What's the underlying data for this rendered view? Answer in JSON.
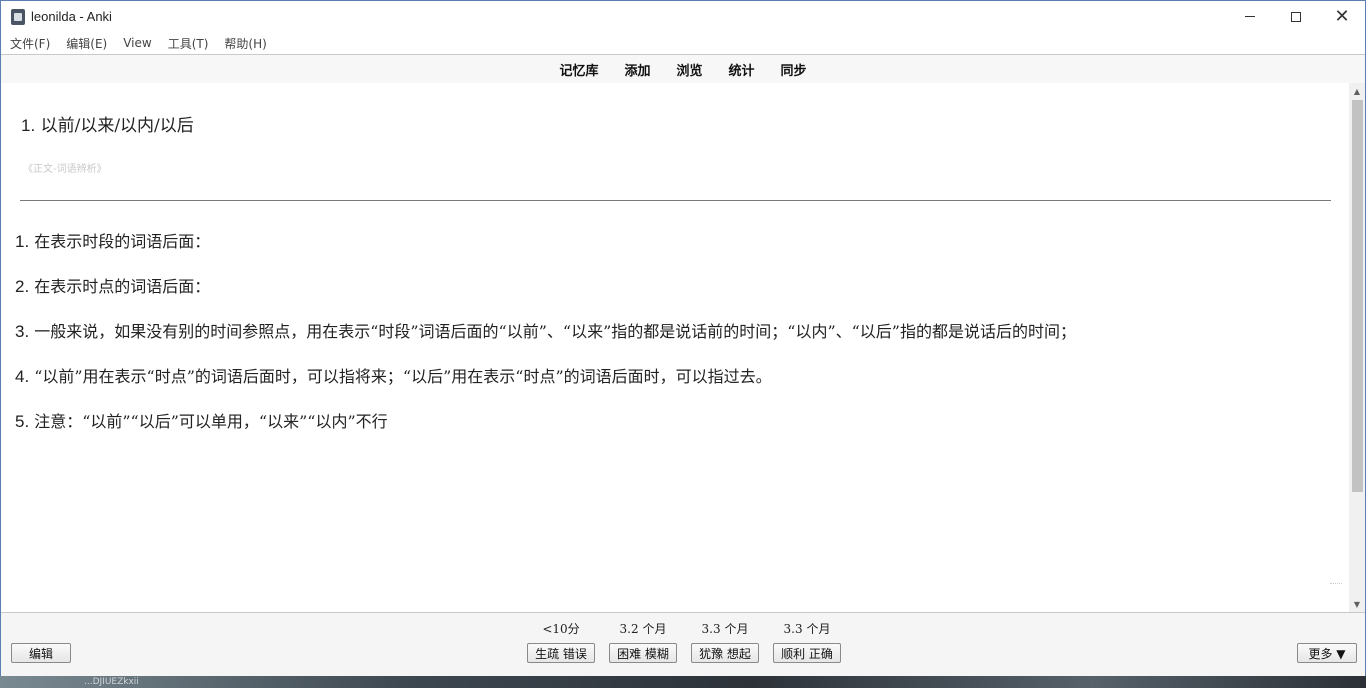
{
  "window": {
    "title": "leonilda - Anki"
  },
  "menubar": {
    "items": [
      "文件(F)",
      "编辑(E)",
      "View",
      "工具(T)",
      "帮助(H)"
    ]
  },
  "toolbar": {
    "items": [
      "记忆库",
      "添加",
      "浏览",
      "统计",
      "同步"
    ]
  },
  "card": {
    "question_num": "1.",
    "question_text": "以前/以来/以内/以后",
    "source": "《正文-词语辨析》",
    "answers": [
      {
        "num": "1.",
        "text": "在表示时段的词语后面："
      },
      {
        "num": "2.",
        "text": "在表示时点的词语后面："
      },
      {
        "num": "3.",
        "text": "一般来说，如果没有别的时间参照点，用在表示“时段”词语后面的“以前”、“以来”指的都是说话前的时间；“以内”、“以后”指的都是说话后的时间；"
      },
      {
        "num": "4.",
        "text": "“以前”用在表示“时点”的词语后面时，可以指将来；“以后”用在表示“时点”的词语后面时，可以指过去。"
      },
      {
        "num": "5.",
        "text": "注意：“以前”“以后”可以单用，“以来”“以内”不行"
      }
    ]
  },
  "bottombar": {
    "edit_label": "编辑",
    "more_label": "更多 ▼",
    "ease": [
      {
        "time": "<10分",
        "label": "生疏 错误"
      },
      {
        "time": "3.2 个月",
        "label": "困难 模糊"
      },
      {
        "time": "3.3 个月",
        "label": "犹豫 想起"
      },
      {
        "time": "3.3 个月",
        "label": "顺利 正确"
      }
    ]
  },
  "desktop": {
    "text": "...DJIUEZkxii"
  },
  "colors": {
    "window_border": "#5a7fb0",
    "divider": "#7a7a7a",
    "source_text": "#c8c8c8"
  },
  "icons": {
    "app": "anki-app-icon",
    "minimize": "minimize-icon",
    "maximize": "maximize-icon",
    "close": "close-icon"
  }
}
